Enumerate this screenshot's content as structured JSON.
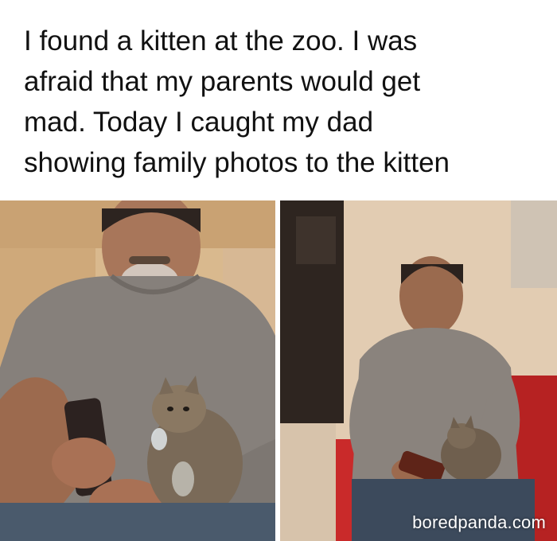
{
  "caption": {
    "lines": [
      "I found a kitten at the zoo. I was",
      "afraid that my parents would get",
      "mad. Today I caught my dad",
      "showing family photos to the kitten"
    ]
  },
  "watermark": "boredpanda.com"
}
